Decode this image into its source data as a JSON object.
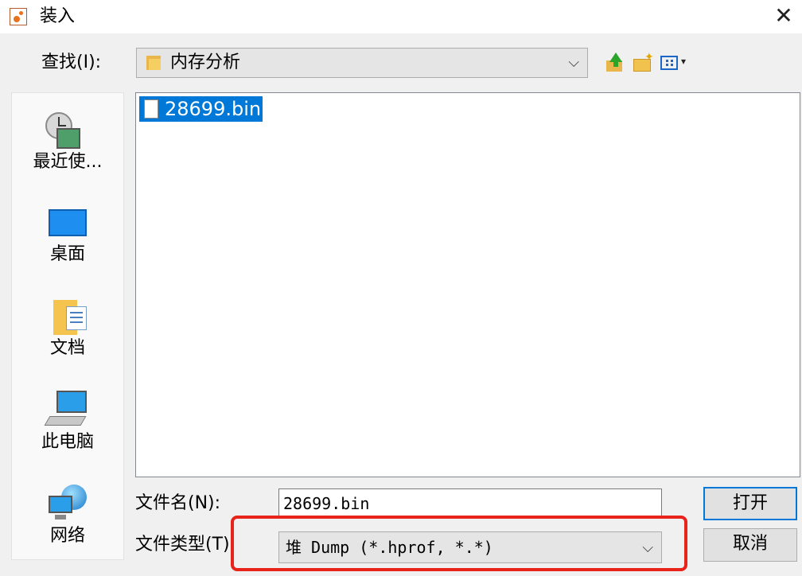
{
  "window": {
    "title": "装入",
    "close_glyph": "✕"
  },
  "toolbar": {
    "look_in_label": "查找(I):",
    "look_in_value": "内存分析",
    "icons": [
      "up-folder-icon",
      "new-folder-icon",
      "view-menu-icon"
    ]
  },
  "places": [
    {
      "label": "最近使...",
      "icon": "recent-items-icon"
    },
    {
      "label": "桌面",
      "icon": "desktop-icon"
    },
    {
      "label": "文档",
      "icon": "documents-icon"
    },
    {
      "label": "此电脑",
      "icon": "this-pc-icon"
    },
    {
      "label": "网络",
      "icon": "network-icon"
    }
  ],
  "files": [
    {
      "name": "28699.bin",
      "selected": true
    }
  ],
  "form": {
    "filename_label": "文件名(N):",
    "filename_value": "28699.bin",
    "filetype_label": "文件类型(T):",
    "filetype_value": "堆 Dump (*.hprof, *.*)"
  },
  "buttons": {
    "open": "打开",
    "cancel": "取消"
  },
  "colors": {
    "selection": "#0078d7",
    "highlight_box": "#e8231a"
  }
}
